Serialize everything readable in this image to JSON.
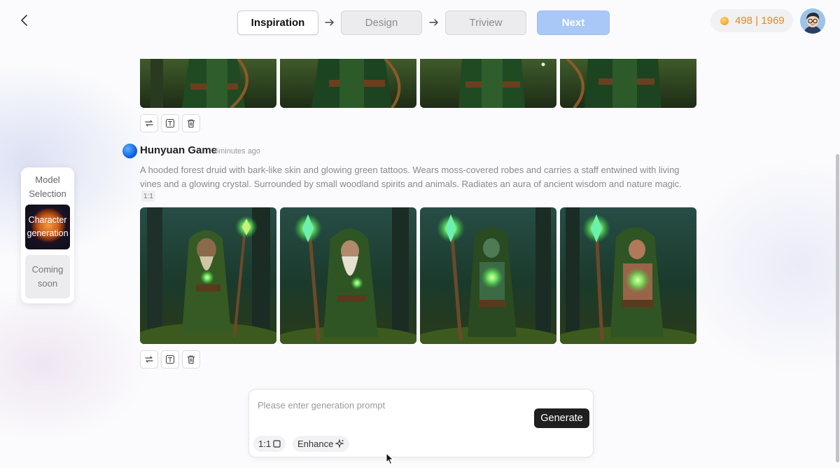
{
  "header": {
    "back_icon": "chevron-left-icon",
    "steps": [
      {
        "label": "Inspiration",
        "state": "active"
      },
      {
        "label": "Design",
        "state": "inactive"
      },
      {
        "label": "Triview",
        "state": "inactive"
      }
    ],
    "next_label": "Next",
    "credits": {
      "text": "498 | 1969",
      "icon": "coin-icon",
      "color": "#e08a14"
    },
    "avatar_icon": "user-avatar"
  },
  "model_panel": {
    "title": "Model Selection",
    "options": [
      {
        "label": "Character generation",
        "selected": true
      },
      {
        "label": "Coming soon",
        "selected": false
      }
    ]
  },
  "feed": {
    "previous": {
      "images": [
        "archer-image-1",
        "archer-image-2",
        "archer-image-3",
        "archer-image-4"
      ],
      "tools": [
        "regenerate-icon",
        "text-icon",
        "delete-icon"
      ]
    },
    "current": {
      "author": "Hunyuan Game",
      "time": "6minutes ago",
      "prompt": "A hooded forest druid with bark-like skin and glowing green tattoos. Wears moss-covered robes and carries a staff entwined with living vines and a glowing crystal. Surrounded by small woodland spirits and animals. Radiates an aura of ancient wisdom and nature magic.",
      "ratio": "1:1",
      "images": [
        "druid-image-1",
        "druid-image-2",
        "druid-image-3",
        "druid-image-4"
      ],
      "tools": [
        "regenerate-icon",
        "text-icon",
        "delete-icon"
      ]
    }
  },
  "input": {
    "placeholder": "Please enter generation prompt",
    "value": "",
    "generate_label": "Generate",
    "ratio_label": "1:1",
    "enhance_label": "Enhance"
  },
  "colors": {
    "accent": "#a9c8f8",
    "generate_bg": "#1f1f1f",
    "credits": "#e08a14"
  }
}
